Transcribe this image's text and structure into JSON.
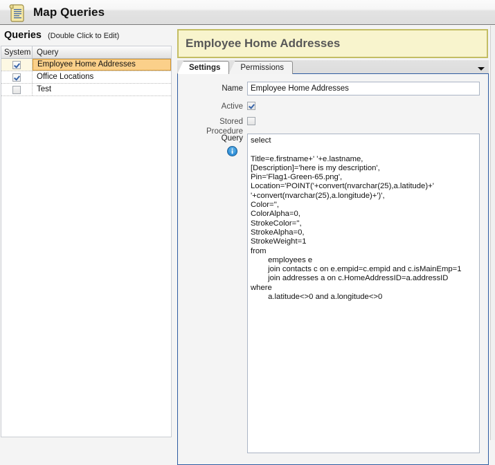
{
  "header": {
    "title": "Map Queries",
    "icon": "scroll-document-icon"
  },
  "left_panel": {
    "heading": "Queries",
    "hint": "(Double Click to Edit)",
    "columns": [
      "System",
      "Query"
    ],
    "rows": [
      {
        "system_checked": true,
        "query": "Employee Home Addresses",
        "selected": true
      },
      {
        "system_checked": true,
        "query": "Office Locations",
        "selected": false
      },
      {
        "system_checked": false,
        "query": "Test",
        "selected": false
      }
    ]
  },
  "right_panel": {
    "banner_title": "Employee Home Addresses",
    "tabs": [
      {
        "label": "Settings",
        "active": true
      },
      {
        "label": "Permissions",
        "active": false
      }
    ],
    "tab_overflow_icon": "chevron-down-icon",
    "form": {
      "name_label": "Name",
      "name_value": "Employee Home Addresses",
      "active_label": "Active",
      "active_checked": true,
      "stored_procedure_label": "Stored Procedure",
      "stored_procedure_checked": false,
      "query_label": "Query",
      "query_info_icon": "info-icon",
      "query_value": "select\n\nTitle=e.firstname+' '+e.lastname,\n[Description]='here is my description',\nPin='Flag1-Green-65.png',\nLocation='POINT('+convert(nvarchar(25),a.latitude)+' '+convert(nvarchar(25),a.longitude)+')',\nColor='',\nColorAlpha=0,\nStrokeColor='',\nStrokeAlpha=0,\nStrokeWeight=1\nfrom\n\temployees e\n\tjoin contacts c on e.empid=c.empid and c.isMainEmp=1\n\tjoin addresses a on c.HomeAddressID=a.addressID\nwhere\n\ta.latitude<>0 and a.longitude<>0"
    }
  },
  "colors": {
    "banner_bg": "#f8f4cd",
    "banner_border": "#c3bd63",
    "selected_row_bg": "#fbd08a",
    "selected_row_border": "#d2942d",
    "panel_border": "#2c5aa0"
  }
}
